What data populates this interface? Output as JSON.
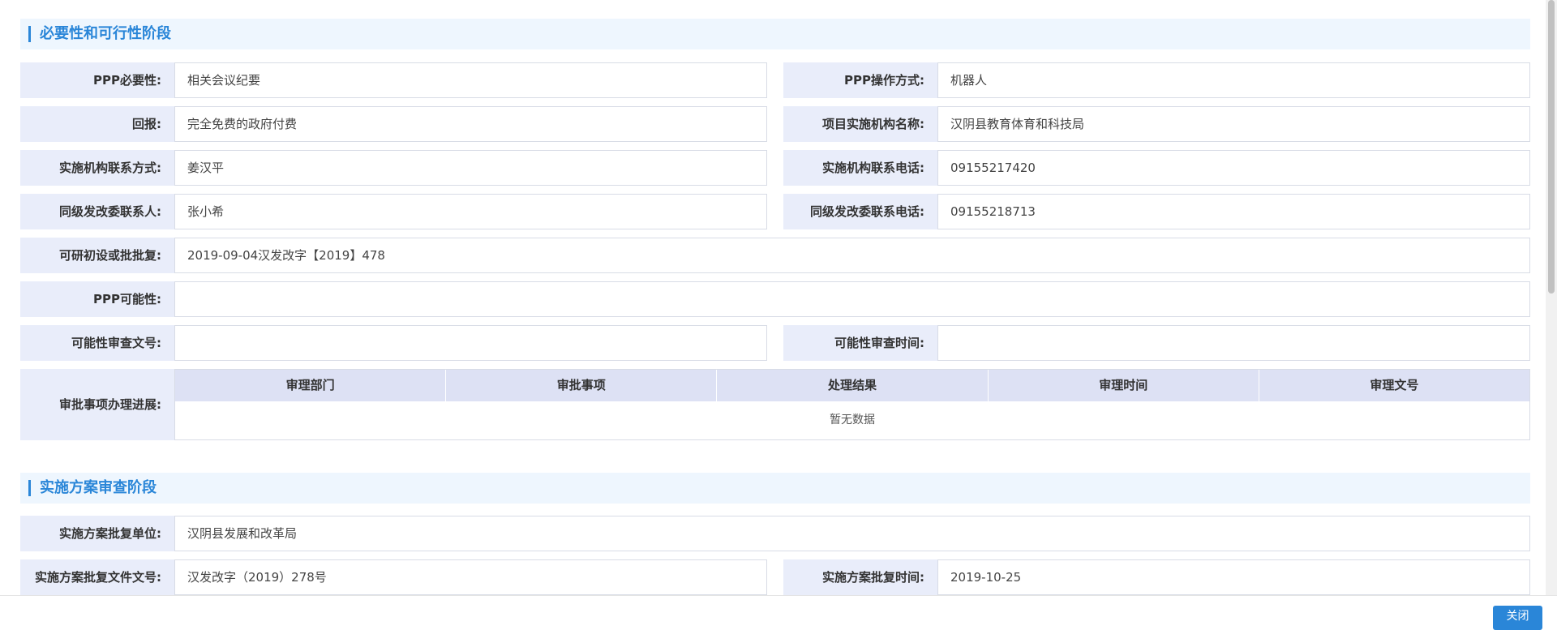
{
  "sections": [
    {
      "title": "必要性和可行性阶段"
    },
    {
      "title": "实施方案审查阶段"
    }
  ],
  "fields": {
    "ppp_necessity": {
      "label": "PPP必要性:",
      "value": "相关会议纪要"
    },
    "ppp_operation": {
      "label": "PPP操作方式:",
      "value": "机器人"
    },
    "return": {
      "label": "回报:",
      "value": "完全免费的政府付费"
    },
    "agency_name": {
      "label": "项目实施机构名称:",
      "value": "汉阴县教育体育和科技局"
    },
    "agency_contact": {
      "label": "实施机构联系方式:",
      "value": "姜汉平"
    },
    "agency_phone": {
      "label": "实施机构联系电话:",
      "value": "09155217420"
    },
    "ndrc_contact": {
      "label": "同级发改委联系人:",
      "value": "张小希"
    },
    "ndrc_phone": {
      "label": "同级发改委联系电话:",
      "value": "09155218713"
    },
    "feasibility_approval": {
      "label": "可研初设或批批复:",
      "value": "2019-09-04汉发改字【2019】478"
    },
    "ppp_feasibility": {
      "label": "PPP可能性:",
      "value": ""
    },
    "feasibility_doc_no": {
      "label": "可能性审查文号:",
      "value": ""
    },
    "feasibility_review_time": {
      "label": "可能性审查时间:",
      "value": ""
    },
    "plan_approval_unit": {
      "label": "实施方案批复单位:",
      "value": "汉阴县发展和改革局"
    },
    "plan_approval_doc_no": {
      "label": "实施方案批复文件文号:",
      "value": "汉发改字（2019）278号"
    },
    "plan_approval_time": {
      "label": "实施方案批复时间:",
      "value": "2019-10-25"
    }
  },
  "approval_progress": {
    "label": "审批事项办理进展:",
    "columns": [
      "审理部门",
      "审批事项",
      "处理结果",
      "审理时间",
      "审理文号"
    ],
    "empty_text": "暂无数据"
  },
  "close_button": {
    "label": "关闭"
  }
}
